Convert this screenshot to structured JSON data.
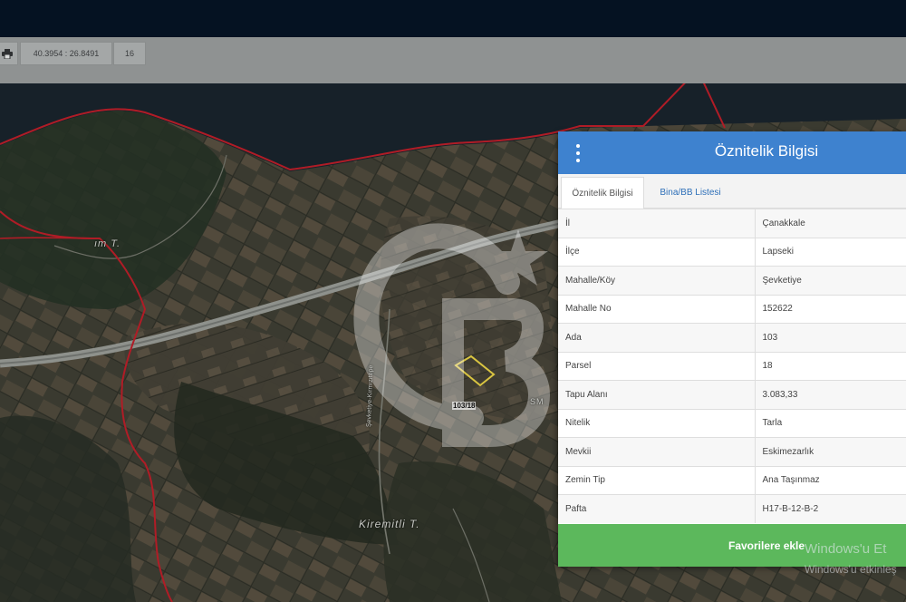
{
  "toolbar": {
    "print_icon": "printer-icon",
    "coords": "40.3954 : 26.8491",
    "zoom": "16"
  },
  "map": {
    "labels": [
      "ım T.",
      "Kiremitli T.",
      "SM"
    ],
    "road_label": "Şevketiye-Kırmızıtepe",
    "parcel_label": "103/18",
    "logo": "CB",
    "colors": {
      "boundary": "#b01c26",
      "parcel": "#d9c441"
    }
  },
  "panel": {
    "menu_icon": "kebab-menu-icon",
    "title": "Öznitelik Bilgisi",
    "tabs": [
      {
        "label": "Öznitelik Bilgisi",
        "active": true
      },
      {
        "label": "Bina/BB Listesi",
        "active": false
      }
    ],
    "rows": [
      {
        "key": "İl",
        "value": "Çanakkale"
      },
      {
        "key": "İlçe",
        "value": "Lapseki"
      },
      {
        "key": "Mahalle/Köy",
        "value": "Şevketiye"
      },
      {
        "key": "Mahalle No",
        "value": "152622"
      },
      {
        "key": "Ada",
        "value": "103"
      },
      {
        "key": "Parsel",
        "value": "18"
      },
      {
        "key": "Tapu Alanı",
        "value": "3.083,33"
      },
      {
        "key": "Nitelik",
        "value": "Tarla"
      },
      {
        "key": "Mevkii",
        "value": "Eskimezarlık"
      },
      {
        "key": "Zemin Tip",
        "value": "Ana Taşınmaz"
      },
      {
        "key": "Pafta",
        "value": "H17-B-12-B-2"
      }
    ],
    "fav_button": "Favorilere ekle",
    "button_color": "#5cb85c",
    "header_color": "#3e82cf"
  },
  "os_watermark": {
    "line1": "Windows'u Et",
    "line2": "Windows'u etkinleş"
  }
}
